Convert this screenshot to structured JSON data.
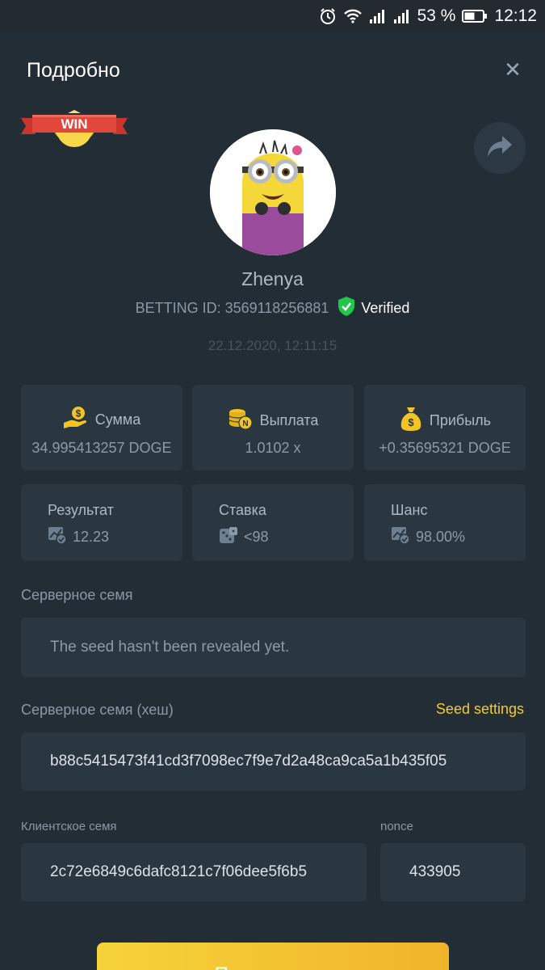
{
  "status_bar": {
    "battery_percent": "53 %",
    "time": "12:12",
    "icons": [
      "alarm-icon",
      "wifi-icon",
      "signal-icon",
      "signal-icon",
      "battery-icon"
    ]
  },
  "header": {
    "title": "Подробно",
    "close_icon": "close-icon"
  },
  "badge": {
    "text": "WIN"
  },
  "profile": {
    "username": "Zhenya",
    "betting_id": "BETTING ID: 3569118256881",
    "verified_label": "Verified",
    "datetime": "22.12.2020, 12:11:15"
  },
  "stats_top": [
    {
      "label": "Сумма",
      "value": "34.995413257 DOGE",
      "icon": "money-hand-icon"
    },
    {
      "label": "Выплата",
      "value": "1.0102 x",
      "icon": "coins-icon"
    },
    {
      "label": "Прибыль",
      "value": "+0.35695321 DOGE",
      "icon": "money-bag-icon"
    }
  ],
  "stats_bottom": [
    {
      "label": "Результат",
      "value": "12.23",
      "icon": "chart-check-icon"
    },
    {
      "label": "Ставка",
      "value": "<98",
      "icon": "dice-icon"
    },
    {
      "label": "Шанс",
      "value": "98.00%",
      "icon": "chart-check-icon"
    }
  ],
  "server_seed": {
    "label": "Серверное семя",
    "value": "The seed hasn't been revealed yet."
  },
  "server_seed_hash": {
    "label": "Серверное семя (хеш)",
    "settings_label": "Seed settings",
    "value": "b88c5415473f41cd3f7098ec7f9e7d2a48ca9ca5a1b435f05"
  },
  "client_seed": {
    "label": "Клиентское семя",
    "value": "2c72e6849c6dafc8121c7f06dee5f6b5"
  },
  "nonce": {
    "label": "nonce",
    "value": "433905"
  },
  "confirm_button": {
    "label": "Подтвердить"
  },
  "colors": {
    "background": "#232d35",
    "card": "#2a3640",
    "accent": "#f2cc2e",
    "verified": "#1fc84a"
  }
}
